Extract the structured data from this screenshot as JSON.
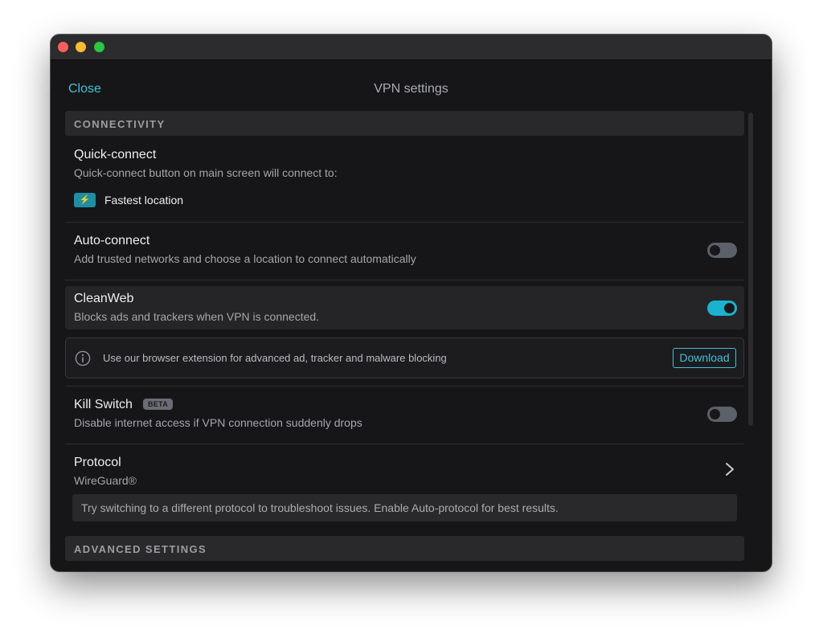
{
  "window": {
    "traffic_lights": [
      "close",
      "minimize",
      "zoom"
    ]
  },
  "header": {
    "close_label": "Close",
    "title": "VPN settings"
  },
  "sections": {
    "connectivity": "CONNECTIVITY",
    "advanced": "ADVANCED SETTINGS"
  },
  "quick_connect": {
    "title": "Quick-connect",
    "description": "Quick-connect button on main screen will connect to:",
    "icon": "lightning-bolt-icon",
    "location": "Fastest location"
  },
  "auto_connect": {
    "title": "Auto-connect",
    "description": "Add trusted networks and choose a location to connect automatically",
    "enabled": false
  },
  "cleanweb": {
    "title": "CleanWeb",
    "description": "Blocks ads and trackers when VPN is connected.",
    "enabled": true
  },
  "extension_notice": {
    "icon": "info-icon",
    "text": "Use our browser extension for advanced ad, tracker and malware blocking",
    "button_label": "Download"
  },
  "kill_switch": {
    "title": "Kill Switch",
    "badge": "BETA",
    "description": "Disable internet access if VPN connection suddenly drops",
    "enabled": false
  },
  "protocol": {
    "title": "Protocol",
    "value": "WireGuard®",
    "hint": "Try switching to a different protocol to troubleshoot issues. Enable Auto-protocol for best results."
  },
  "colors": {
    "accent": "#3fc1d9",
    "toggle_on": "#19b3cf",
    "toggle_off": "#5c6068",
    "background": "#161618"
  }
}
